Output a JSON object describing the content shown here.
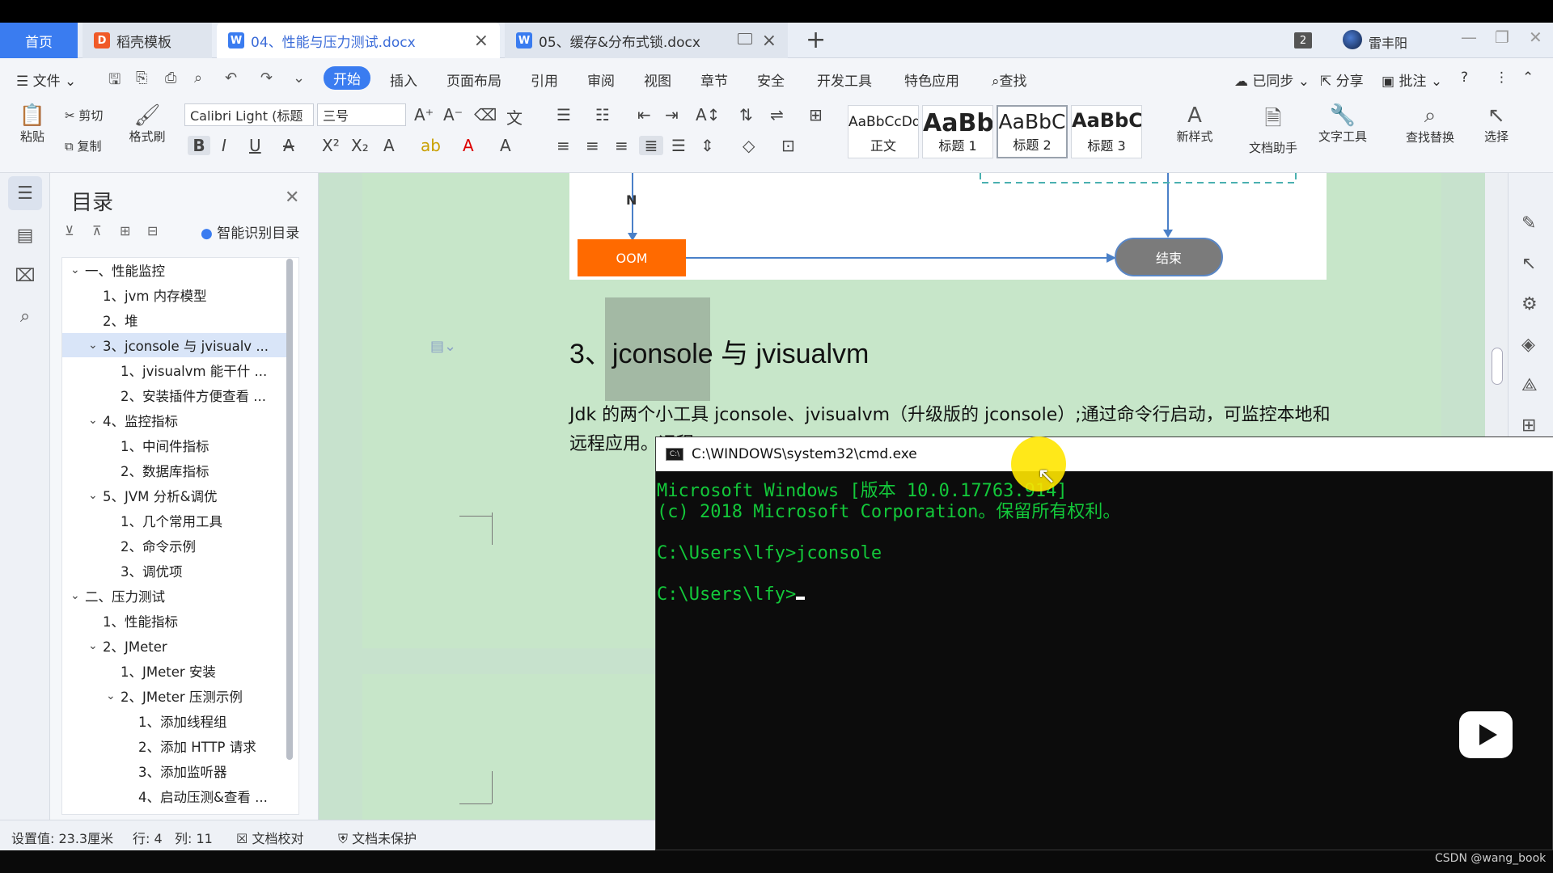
{
  "tabs": {
    "home": "首页",
    "daoke": "稻壳模板",
    "doc1": "04、性能与压力测试.docx",
    "doc2": "05、缓存&分布式锁.docx",
    "badge": "2",
    "username": "雷丰阳"
  },
  "menu": {
    "file": "文件",
    "items": [
      "开始",
      "插入",
      "页面布局",
      "引用",
      "审阅",
      "视图",
      "章节",
      "安全",
      "开发工具",
      "特色应用",
      "查找"
    ],
    "synced": "已同步",
    "share": "分享",
    "comment": "批注"
  },
  "ribbon": {
    "paste": "粘贴",
    "cut": "剪切",
    "copy": "复制",
    "format_painter": "格式刷",
    "font_name": "Calibri Light (标题",
    "font_size": "三号",
    "styles": [
      {
        "sample": "AaBbCcDd",
        "name": "正文"
      },
      {
        "sample": "AaBb",
        "name": "标题 1"
      },
      {
        "sample": "AaBbC",
        "name": "标题 2"
      },
      {
        "sample": "AaBbC",
        "name": "标题 3"
      }
    ],
    "new_style": "新样式",
    "doc_assistant": "文档助手",
    "text_tools": "文字工具",
    "find_replace": "查找替换",
    "select": "选择"
  },
  "toc": {
    "title": "目录",
    "smart": "智能识别目录",
    "items": [
      {
        "text": "一、性能监控",
        "level": 0,
        "chev": true
      },
      {
        "text": "1、jvm 内存模型",
        "level": 1,
        "chev": false
      },
      {
        "text": "2、堆",
        "level": 1,
        "chev": false
      },
      {
        "text": "3、jconsole 与 jvisualv ...",
        "level": 1,
        "chev": true,
        "selected": true
      },
      {
        "text": "1、jvisualvm 能干什 ...",
        "level": 2,
        "chev": false
      },
      {
        "text": "2、安装插件方便查看 ...",
        "level": 2,
        "chev": false
      },
      {
        "text": "4、监控指标",
        "level": 1,
        "chev": true
      },
      {
        "text": "1、中间件指标",
        "level": 2,
        "chev": false
      },
      {
        "text": "2、数据库指标",
        "level": 2,
        "chev": false
      },
      {
        "text": "5、JVM 分析&调优",
        "level": 1,
        "chev": true
      },
      {
        "text": "1、几个常用工具",
        "level": 2,
        "chev": false
      },
      {
        "text": "2、命令示例",
        "level": 2,
        "chev": false
      },
      {
        "text": "3、调优项",
        "level": 2,
        "chev": false
      },
      {
        "text": "二、压力测试",
        "level": 0,
        "chev": true
      },
      {
        "text": "1、性能指标",
        "level": 1,
        "chev": false
      },
      {
        "text": "2、JMeter",
        "level": 1,
        "chev": true
      },
      {
        "text": "1、JMeter 安装",
        "level": 2,
        "chev": false
      },
      {
        "text": "2、JMeter 压测示例",
        "level": 2,
        "chev": true
      },
      {
        "text": "1、添加线程组",
        "level": 3,
        "chev": false
      },
      {
        "text": "2、添加 HTTP 请求",
        "level": 3,
        "chev": false
      },
      {
        "text": "3、添加监听器",
        "level": 3,
        "chev": false
      },
      {
        "text": "4、启动压测&查看 ...",
        "level": 3,
        "chev": false
      }
    ]
  },
  "doc": {
    "n_label": "N",
    "oom": "OOM",
    "end": "结束",
    "heading": "3、jconsole 与 jvisualvm",
    "para_line1": "Jdk 的两个小工具 jconsole、jvisualvm（升级版的 jconsole）;通过命令行启动，可监控本地和",
    "para_line2": "远程应用。远程"
  },
  "cmd": {
    "title": "C:\\WINDOWS\\system32\\cmd.exe",
    "lines": [
      "Microsoft Windows [版本 10.0.17763.914]",
      "(c) 2018 Microsoft Corporation。保留所有权利。",
      "",
      "C:\\Users\\lfy>jconsole",
      "",
      "C:\\Users\\lfy>"
    ]
  },
  "status": {
    "setting": "设置值: 23.3厘米",
    "row": "行: 4",
    "col": "列: 11",
    "proof": "文档校对",
    "protect": "文档未保护"
  },
  "watermark": "CSDN @wang_book"
}
